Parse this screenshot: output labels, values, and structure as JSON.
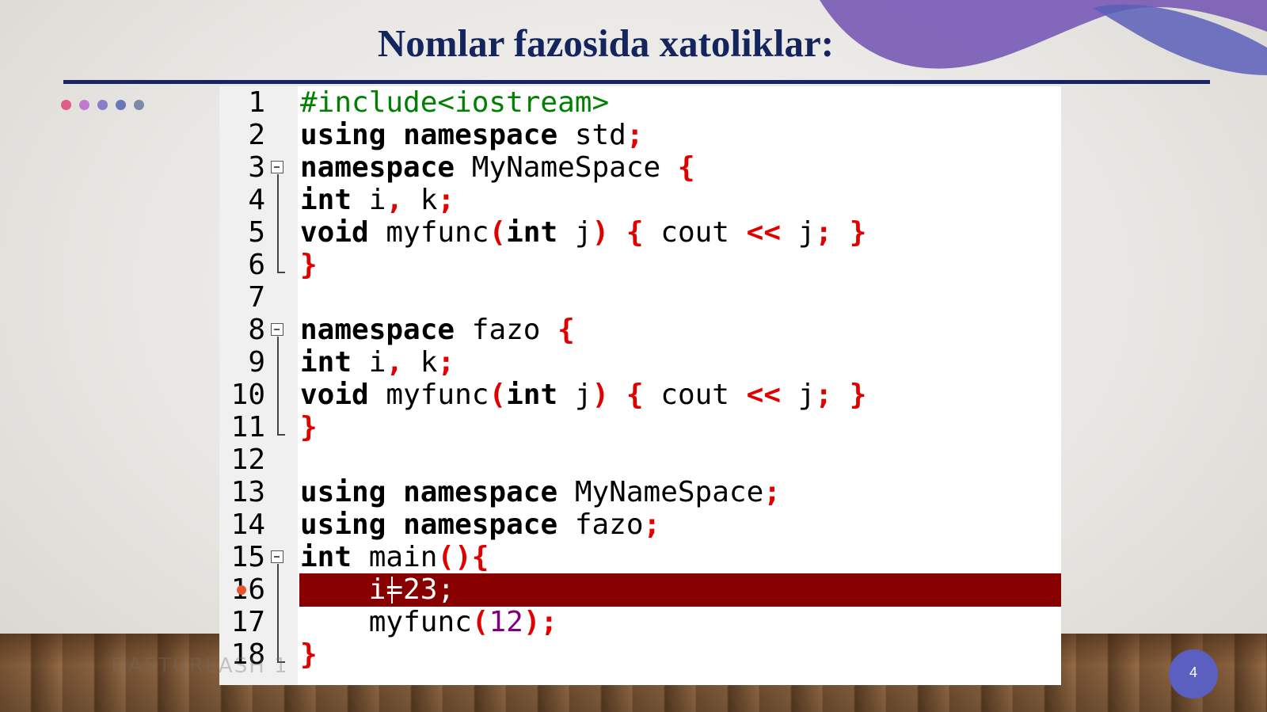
{
  "slide": {
    "title": "Nomlar fazosida xatoliklar:",
    "page_number": "4",
    "watermark": "DASTURLASH 1"
  },
  "colors": {
    "title": "#14245c",
    "accent_wave": "#7a5cb6",
    "highlight_line": "#880000",
    "keyword_punct": "#e00000",
    "preprocessor": "#008000",
    "number": "#800080",
    "page_badge": "#5a5fc0"
  },
  "dots": [
    "#e05c8a",
    "#c07ad0",
    "#8a7ec8",
    "#6b78b8",
    "#7a8aa8"
  ],
  "editor": {
    "current_line": "16",
    "lines": [
      {
        "n": "1",
        "text": "#include<iostream>"
      },
      {
        "n": "2",
        "text": "using namespace std;"
      },
      {
        "n": "3",
        "text": "namespace MyNameSpace {"
      },
      {
        "n": "4",
        "text": "int i, k;"
      },
      {
        "n": "5",
        "text": "void myfunc(int j) { cout << j; }"
      },
      {
        "n": "6",
        "text": "}"
      },
      {
        "n": "7",
        "text": ""
      },
      {
        "n": "8",
        "text": "namespace fazo {"
      },
      {
        "n": "9",
        "text": "int i, k;"
      },
      {
        "n": "10",
        "text": "void myfunc(int j) { cout << j; }"
      },
      {
        "n": "11",
        "text": "}"
      },
      {
        "n": "12",
        "text": ""
      },
      {
        "n": "13",
        "text": "using namespace MyNameSpace;"
      },
      {
        "n": "14",
        "text": "using namespace fazo;"
      },
      {
        "n": "15",
        "text": "int main(){"
      },
      {
        "n": "16",
        "text": "    i=23;"
      },
      {
        "n": "17",
        "text": "    myfunc(12);"
      },
      {
        "n": "18",
        "text": "}"
      }
    ]
  }
}
